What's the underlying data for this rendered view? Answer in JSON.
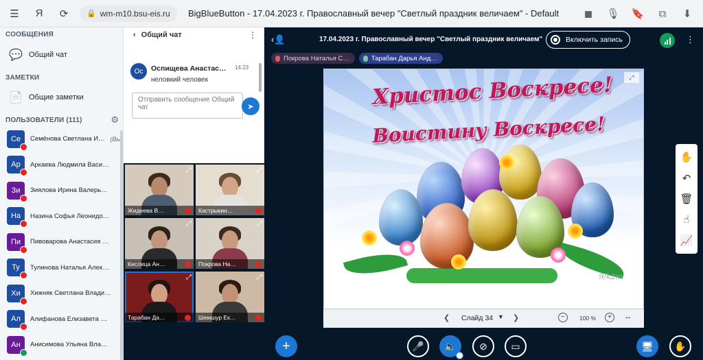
{
  "browser": {
    "url": "wm-m10.bsu-eis.ru",
    "title": "BigBlueButton - 17.04.2023 г. Православный вечер \"Светлый праздник величаем\" - Default",
    "icons": [
      "menu-icon",
      "yandex-icon",
      "reload-icon",
      "lock-icon",
      "camera-icon",
      "microphone-icon",
      "bookmark-icon",
      "extensions-icon",
      "download-icon"
    ]
  },
  "sidebar": {
    "messages_title": "СООБЩЕНИЯ",
    "public_chat": "Общий чат",
    "notes_title": "ЗАМЕТКИ",
    "shared_notes": "Общие заметки",
    "users_title": "ПОЛЬЗОВАТЕЛИ (111)",
    "users": [
      {
        "initials": "Се",
        "name": "Семёнова Светлана Иван…",
        "you": "(Вы)",
        "color": "#1d4ea2"
      },
      {
        "initials": "Ар",
        "name": "Аркаева Людмила Васильевна",
        "color": "#1d4ea2"
      },
      {
        "initials": "Зи",
        "name": "Зиялова Ирина Валерьевна",
        "color": "#6a1b9a"
      },
      {
        "initials": "На",
        "name": "Назина Софья Леонидовна",
        "color": "#1d4ea2"
      },
      {
        "initials": "Пи",
        "name": "Пивоварова Анастасия Сергее…",
        "color": "#6a1b9a"
      },
      {
        "initials": "Ту",
        "name": "Тулинова Наталья Александров…",
        "color": "#1d4ea2"
      },
      {
        "initials": "Хи",
        "name": "Хижняк Светлана Владимиров…",
        "color": "#1d4ea2"
      },
      {
        "initials": "Ал",
        "name": "Алифанова Елизавета Сергее…",
        "color": "#1d4ea2"
      },
      {
        "initials": "Ан",
        "name": "Анисимова Ульяна Владимиров…",
        "color": "#6a1b9a"
      }
    ]
  },
  "chat": {
    "header": "Общий чат",
    "message": {
      "avatar": "Ос",
      "author": "Оспищева Анастасия…",
      "time": "14:23",
      "text": "неловкий человек"
    },
    "input_placeholder": "Отправить сообщение Общий чат"
  },
  "videos": [
    {
      "label": "Жидеева В…"
    },
    {
      "label": "Кастрыкин…"
    },
    {
      "label": "Кислица Ан…"
    },
    {
      "label": "Покрова На…"
    },
    {
      "label": "Тарабан Да…"
    },
    {
      "label": "Шемшур Ек…"
    }
  ],
  "main": {
    "meeting_title": "17.04.2023 г. Православный вечер \"Светлый праздник величаем\"",
    "record_label": "Включить запись",
    "talkers": [
      {
        "name": "Покрова Наталья С…",
        "active": false
      },
      {
        "name": "Тарабан Дарья Анд…",
        "active": true
      }
    ]
  },
  "slide": {
    "line1": "Христос Воскресе!",
    "line2": "Воистину Воскресе!",
    "signature": "9/k2m",
    "label": "Слайд 34",
    "zoom": "100 %"
  },
  "tools": [
    "hand-icon",
    "undo-icon",
    "trash-icon",
    "multi-user-icon",
    "whiteboard-icon"
  ],
  "bottom": [
    "plus-icon",
    "mic-off-icon",
    "speaker-icon",
    "camera-off-icon",
    "screenshare-off-icon",
    "presentation-icon",
    "raise-hand-icon"
  ]
}
